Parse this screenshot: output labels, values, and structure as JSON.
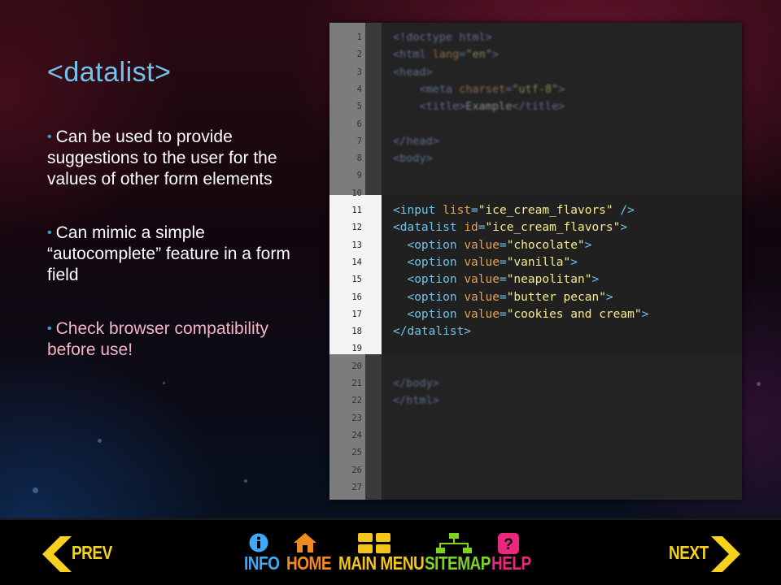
{
  "slide": {
    "title": "<datalist>",
    "bullets": [
      "Can be used to provide suggestions to the user for the values of other form elements",
      "Can mimic a simple “autocomplete” feature in a form field",
      "Check browser compatibility before use!"
    ]
  },
  "editor": {
    "line_numbers": [
      "1",
      "2",
      "3",
      "4",
      "5",
      "6",
      "7",
      "8",
      "9",
      "10",
      "11",
      "12",
      "13",
      "14",
      "15",
      "16",
      "17",
      "18",
      "19",
      "20",
      "21",
      "22",
      "23",
      "24",
      "25",
      "26",
      "27"
    ]
  },
  "nav": {
    "prev": "PREV",
    "info": "INFO",
    "home": "HOME",
    "main_menu": "MAIN MENU",
    "sitemap": "SITEMAP",
    "help": "HELP",
    "next": "NEXT"
  },
  "colors": {
    "title": "#6fc3ec",
    "warning_bullet": "#f2b5c4",
    "prev_next": "#f7d21c",
    "info": "#3fa9f5",
    "home": "#f28b1d",
    "main_menu": "#f3c41a",
    "sitemap": "#7ed321",
    "help": "#e8277d"
  }
}
